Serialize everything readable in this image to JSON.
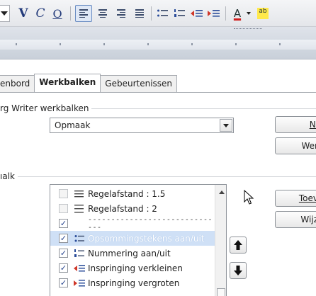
{
  "toolbar": {
    "icons": [
      "dropdown-arrow-icon",
      "bold-icon",
      "italic-icon",
      "underline-icon",
      "align-left-icon",
      "align-center-icon",
      "align-right-icon",
      "justify-icon",
      "bullets-icon",
      "numbering-icon",
      "decrease-indent-icon",
      "increase-indent-icon",
      "font-color-icon",
      "highlight-icon"
    ],
    "bold_glyph": "V",
    "italic_glyph": "C",
    "underline_glyph": "O",
    "font_color_glyph": "A",
    "highlight_glyph": "ab",
    "accent_color": "#d01c1c",
    "highlight_color": "#ffe94a"
  },
  "dialog": {
    "tabs": [
      {
        "label": "enbord",
        "active": false
      },
      {
        "label": "Werkbalken",
        "active": true
      },
      {
        "label": "Gebeurtenissen",
        "active": false
      }
    ],
    "toolbars_group_label": "rg Writer werkbalken",
    "toolbar_select_value": "Opmaak",
    "buttons_top": [
      {
        "label": "Ni"
      },
      {
        "label": "Wer"
      }
    ],
    "content_group_label": "ıalk",
    "buttons_side": [
      {
        "label": "Toev"
      },
      {
        "label": "Wijz"
      }
    ],
    "commands": [
      {
        "label": "Regelafstand : 1.5",
        "checked": false,
        "icon": "line-spacing-icon"
      },
      {
        "label": "Regelafstand : 2",
        "checked": false,
        "icon": "line-spacing-icon"
      },
      {
        "label": "------------------------------",
        "checked": true,
        "icon": ""
      },
      {
        "label": "Opsommingstekens aan/uit",
        "checked": true,
        "icon": "bullets-icon",
        "selected": true
      },
      {
        "label": "Nummering aan/uit",
        "checked": true,
        "icon": "numbering-icon"
      },
      {
        "label": "Inspringing verkleinen",
        "checked": true,
        "icon": "decrease-indent-icon"
      },
      {
        "label": "Inspringing vergroten",
        "checked": true,
        "icon": "increase-indent-icon"
      }
    ],
    "selection_color": "#cfe0f6"
  }
}
